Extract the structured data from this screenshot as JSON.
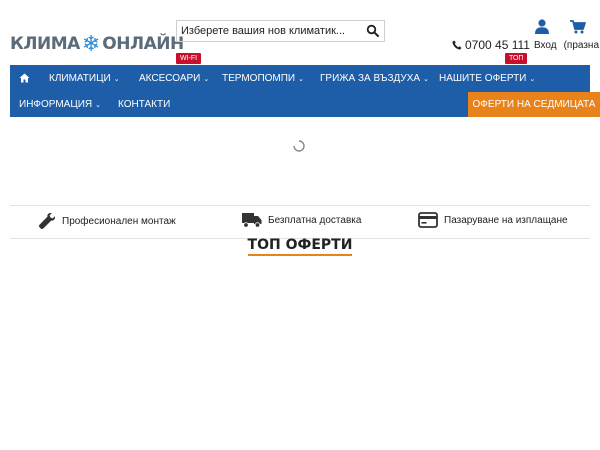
{
  "header": {
    "logo_left": "КЛИМА",
    "logo_right": "ОНЛАЙН",
    "search_placeholder": "Изберете вашия нов климатик...",
    "badge_wifi": "WI-FI",
    "badge_top": "ТОП",
    "phone": "0700 45 111",
    "login": "Вход",
    "cart": "(празна"
  },
  "nav": {
    "items": [
      {
        "label": "КЛИМАТИЦИ"
      },
      {
        "label": "АКСЕСОАРИ"
      },
      {
        "label": "ТЕРМОПОМПИ"
      },
      {
        "label": "ГРИЖА ЗА ВЪЗДУХА"
      },
      {
        "label": "НАШИТЕ ОФЕРТИ"
      },
      {
        "label": "ИНФОРМАЦИЯ"
      },
      {
        "label": "КОНТАКТИ"
      }
    ],
    "weekly_offers": "ОФЕРТИ НА СЕДМИЦАТА"
  },
  "features": [
    {
      "icon": "wrench-icon",
      "label": "Професионален монтаж"
    },
    {
      "icon": "truck-icon",
      "label": "Безплатна доставка"
    },
    {
      "icon": "credit-card-icon",
      "label": "Пазаруване на изплащане"
    }
  ],
  "section": {
    "title": "ТОП ОФЕРТИ"
  },
  "colors": {
    "nav_bg": "#1e5ea8",
    "accent": "#e8821a",
    "badge": "#c8102e",
    "brand_blue": "#2a8ad6"
  }
}
